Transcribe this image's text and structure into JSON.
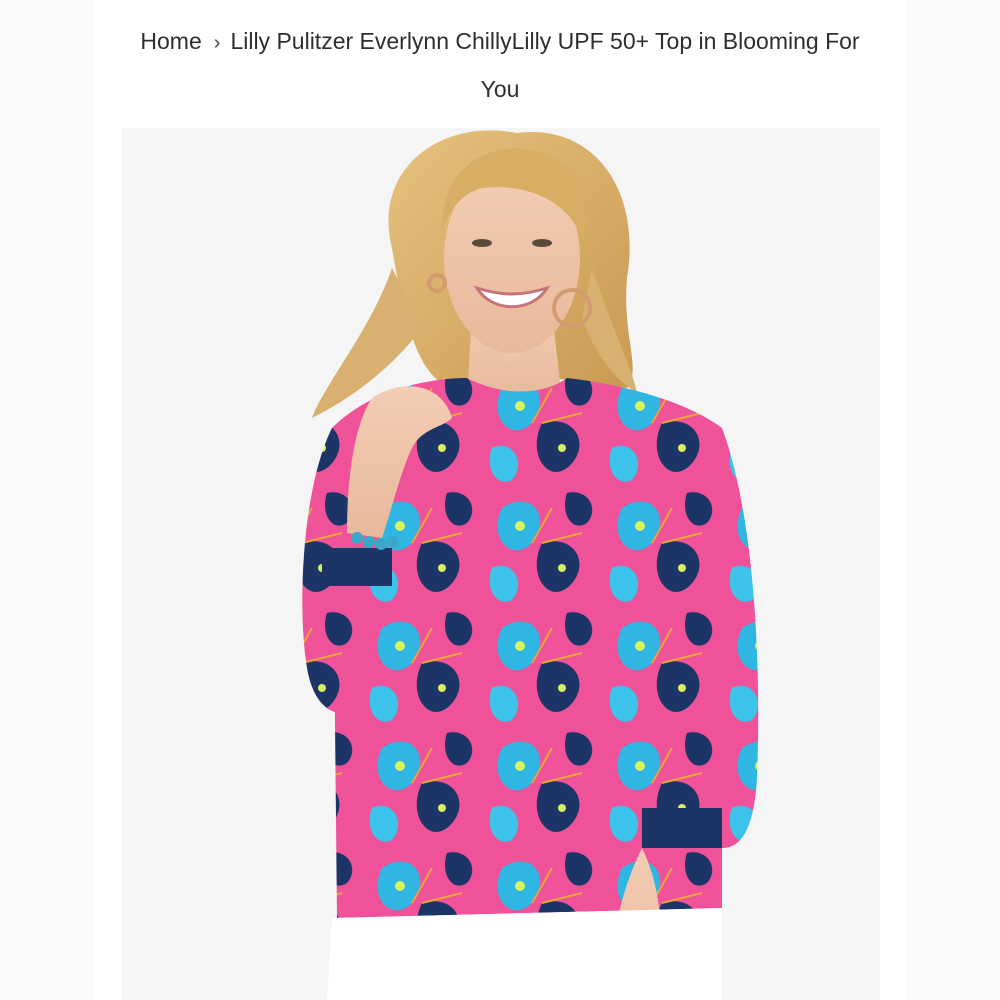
{
  "breadcrumb": {
    "home": "Home",
    "separator": "›",
    "current": "Lilly Pulitzer Everlynn ChillyLilly UPF 50+ Top in Blooming For You"
  },
  "colors": {
    "background": "#ffffff",
    "text": "#2e2e2e",
    "garment_pink": "#f0529a",
    "garment_turquoise": "#2fb6e3",
    "garment_navy": "#1d3466"
  },
  "image": {
    "icon": "product-photo"
  }
}
